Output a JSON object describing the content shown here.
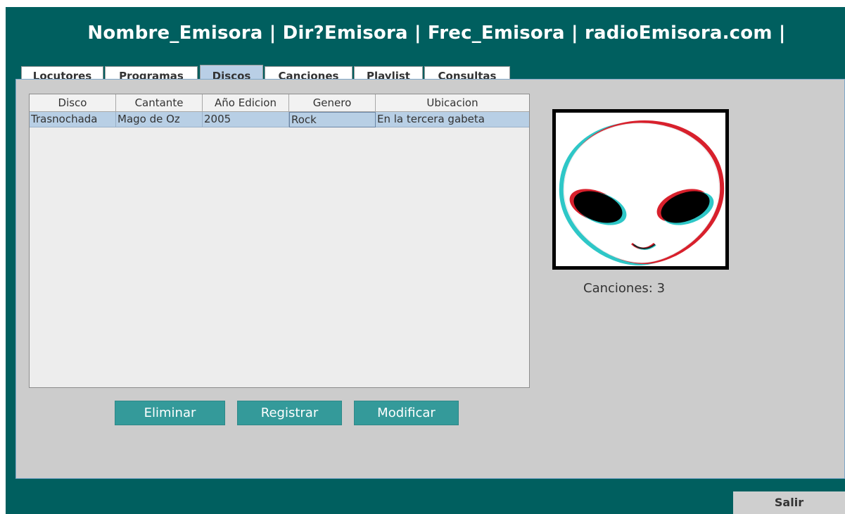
{
  "header": {
    "title": "Nombre_Emisora | Dir?Emisora | Frec_Emisora | radioEmisora.com |"
  },
  "tabs": [
    {
      "label": "Locutores",
      "active": false
    },
    {
      "label": "Programas",
      "active": false
    },
    {
      "label": "Discos",
      "active": true
    },
    {
      "label": "Canciones",
      "active": false
    },
    {
      "label": "Playlist",
      "active": false
    },
    {
      "label": "Consultas",
      "active": false
    }
  ],
  "table": {
    "columns": [
      "Disco",
      "Cantante",
      "Año Edicion",
      "Genero",
      "Ubicacion"
    ],
    "rows": [
      [
        "Trasnochada",
        "Mago de Oz",
        "2005",
        "Rock",
        "En la tercera gabeta"
      ]
    ],
    "selected_row": 0
  },
  "buttons": {
    "delete_label": "Eliminar",
    "register_label": "Registrar",
    "modify_label": "Modificar"
  },
  "album": {
    "image_icon": "alien-face-icon",
    "songs_count_text": "Canciones: 3"
  },
  "footer": {
    "exit_label": "Salir"
  },
  "colors": {
    "window_bg": "#005f5f",
    "panel_bg": "#cccccc",
    "button_bg": "#349a9a",
    "selection_bg": "#b8cfe5"
  }
}
